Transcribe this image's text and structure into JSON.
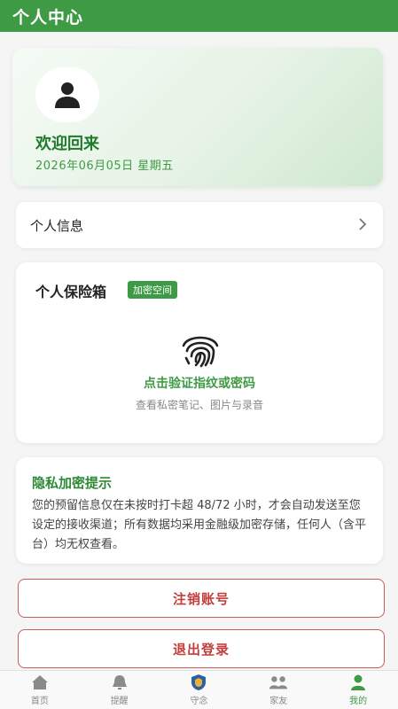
{
  "header": {
    "title": "个人中心"
  },
  "welcome": {
    "title": "欢迎回来",
    "date": "2026年06月05日  星期五",
    "avatar_icon": "user-icon"
  },
  "personal_info": {
    "label": "个人信息",
    "chevron_icon": "chevron-right-icon"
  },
  "vault": {
    "title": "个人保险箱",
    "badge": "加密空间",
    "icon": "fingerprint-icon",
    "action": "点击验证指纹或密码",
    "description": "查看私密笔记、图片与录音"
  },
  "privacy_tip": {
    "title": "隐私加密提示",
    "body": "您的预留信息仅在未按时打卡超 48/72 小时，才会自动发送至您设定的接收渠道；所有数据均采用金融级加密存储，任何人（含平台）均无权查看。"
  },
  "actions": {
    "delete_account": "注销账号",
    "logout": "退出登录"
  },
  "nav": {
    "items": [
      {
        "label": "首页",
        "icon": "home-icon"
      },
      {
        "label": "提醒",
        "icon": "bell-icon"
      },
      {
        "label": "守念",
        "icon": "shield-badge-icon"
      },
      {
        "label": "家友",
        "icon": "family-icon"
      },
      {
        "label": "我的",
        "icon": "user-icon"
      }
    ],
    "active_index": 4
  },
  "colors": {
    "brand_green": "#3f9a45",
    "danger_red": "#c43d3d"
  }
}
